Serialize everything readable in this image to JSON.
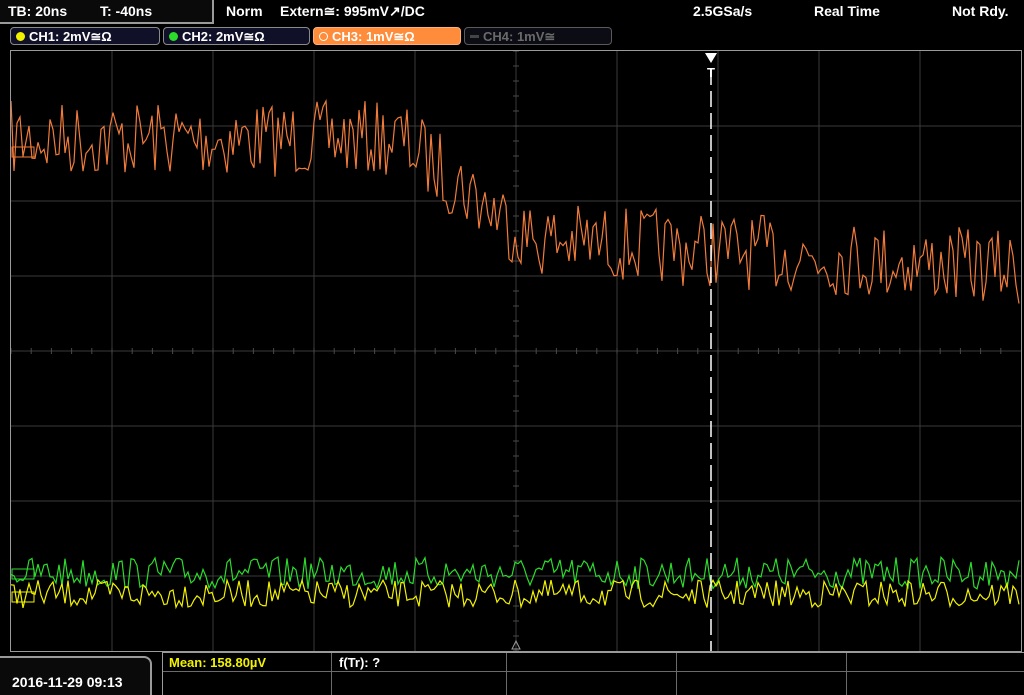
{
  "status": {
    "timebase": "TB: 20ns",
    "trigger_offset": "T: -40ns",
    "mode": "Norm",
    "trigger_source": "Extern≅: 995mV↗/DC",
    "sample_rate": "2.5GSa/s",
    "acq_mode": "Real Time",
    "ready_state": "Not Rdy."
  },
  "channels": [
    {
      "label": "CH1: 2mV≅Ω",
      "color": "#f2f200",
      "active": true,
      "selected": false
    },
    {
      "label": "CH2: 2mV≅Ω",
      "color": "#2bdc2b",
      "active": true,
      "selected": false
    },
    {
      "label": "CH3: 1mV≅Ω",
      "color": "#ff8c3a",
      "active": true,
      "selected": true
    },
    {
      "label": "CH4: 1mV≅",
      "color": "#555555",
      "active": false,
      "selected": false
    }
  ],
  "trigger_marker": "T",
  "footer": {
    "datetime": "2016-11-29 09:13",
    "meas1": "Mean: 158.80µV",
    "meas2": "f(Tr): ?"
  },
  "colors": {
    "ch1": "#f2f200",
    "ch2": "#2bdc2b",
    "ch3": "#f07b3a",
    "grid": "#3a3a3a",
    "accent": "#ff8c3a"
  }
}
